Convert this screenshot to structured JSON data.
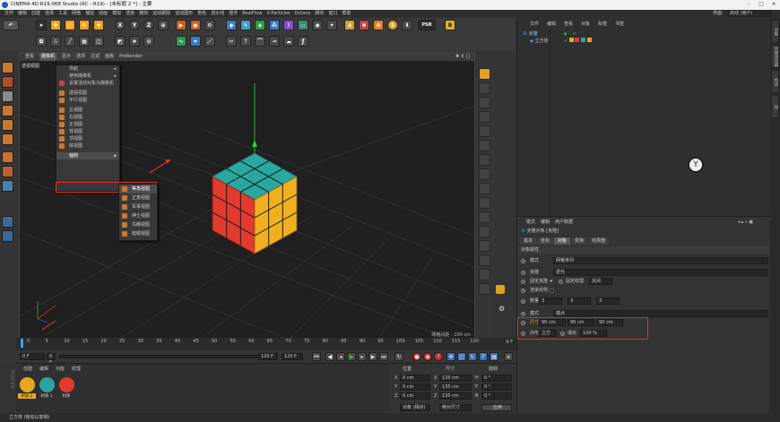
{
  "window": {
    "title": "CINEMA 4D R19.068 Studio (RC - R19) - [未标题 2 *] - 主要"
  },
  "menubar": {
    "items": [
      "文件",
      "编辑",
      "创建",
      "选择",
      "工具",
      "网格",
      "捕捉",
      "动画",
      "模拟",
      "渲染",
      "雕刻",
      "运动跟踪",
      "运动图形",
      "角色",
      "流水线",
      "插件",
      "RealFlow",
      "X-Particles",
      "Octane",
      "脚本",
      "窗口",
      "帮助"
    ],
    "layout_label": "界面:",
    "layout_value": "启动 (用户)"
  },
  "toolbar": {
    "psr_label": "PSR",
    "psr_value": "0"
  },
  "viewport": {
    "menu": [
      "查看",
      "摄像机",
      "显示",
      "选项",
      "过滤",
      "面板",
      "ProRender"
    ],
    "label": "透视视图",
    "footer": "网格间距 : 100 cm",
    "camera_menu": {
      "items": [
        "导航",
        "使用摄像机",
        "设置活动对象为摄像机",
        "透视视图",
        "平行视图",
        "左视图",
        "右视图",
        "正视图",
        "背视图",
        "顶视图",
        "底视图",
        "轴侧"
      ],
      "submenu": [
        "等角视图",
        "正角视图",
        "军事视图",
        "绅士视图",
        "鸟瞰视图",
        "蛙眼视图"
      ]
    }
  },
  "timeline": {
    "ticks": [
      "0",
      "5",
      "10",
      "15",
      "20",
      "25",
      "30",
      "35",
      "40",
      "45",
      "50",
      "55",
      "60",
      "65",
      "70",
      "75",
      "80",
      "85",
      "90",
      "95",
      "100",
      "105",
      "110",
      "115",
      "120"
    ],
    "frame_end": "0 F"
  },
  "transport": {
    "start": "0 F",
    "current": "0 F",
    "end_a": "120 F",
    "end_b": "120 F"
  },
  "material_panel": {
    "menu": [
      "创建",
      "编辑",
      "功能",
      "纹理"
    ],
    "materials": [
      {
        "name": "材质.2",
        "color": "#e8a81e"
      },
      {
        "name": "材质.1",
        "color": "#2aa5a0"
      },
      {
        "name": "材质",
        "color": "#e23a2f"
      }
    ]
  },
  "coord_panel": {
    "headers": [
      "位置",
      "尺寸",
      "旋转"
    ],
    "rows": [
      {
        "axis": "X",
        "pos": "0 cm",
        "size": "135 cm",
        "rot_label": "H",
        "rot": "0 °"
      },
      {
        "axis": "Y",
        "pos": "0 cm",
        "size": "135 cm",
        "rot_label": "P",
        "rot": "0 °"
      },
      {
        "axis": "Z",
        "pos": "0 cm",
        "size": "135 cm",
        "rot_label": "B",
        "rot": "0 °"
      }
    ],
    "mode1": "对象 (相对)",
    "mode2": "绝对尺寸",
    "apply": "应用"
  },
  "object_manager": {
    "menu": [
      "文件",
      "编辑",
      "查看",
      "对象",
      "标签",
      "书签"
    ],
    "objects": [
      {
        "name": "克隆"
      },
      {
        "name": "立方体"
      }
    ]
  },
  "attr_manager": {
    "menu": [
      "模式",
      "编辑",
      "用户数据"
    ],
    "object_title": "克隆对象 [克隆]",
    "tabs": [
      "基本",
      "坐标",
      "对象",
      "变换",
      "效果器"
    ],
    "section": "对象属性",
    "mode_label": "模式",
    "mode_value": "网格排列",
    "clone_label": "克隆",
    "clone_value": "迭代",
    "fix_clone": "固定克隆",
    "fix_texture": "固定纹理",
    "fix_texture_value": "关闭",
    "render_instance": "渲染实例",
    "count_label": "数量",
    "count": [
      "3",
      "3",
      "3"
    ],
    "mode2_label": "模式",
    "mode2_value": "端点",
    "size_label": "尺寸",
    "size": [
      "90 cm",
      "90 cm",
      "90 cm"
    ],
    "shape_label": "外形",
    "shape_value": "立方",
    "fill_label": "填充",
    "fill_value": "100 %"
  },
  "right_tabs": [
    "对象",
    "内容浏览器",
    "构造",
    "层"
  ],
  "status": "立方体 (拖动以复制)"
}
